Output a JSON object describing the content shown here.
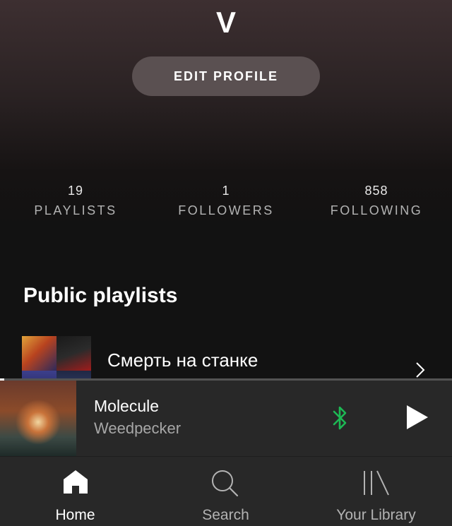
{
  "profile": {
    "username": "V",
    "edit_button_label": "EDIT PROFILE",
    "stats": [
      {
        "value": "19",
        "label": "PLAYLISTS"
      },
      {
        "value": "1",
        "label": "FOLLOWERS"
      },
      {
        "value": "858",
        "label": "FOLLOWING"
      }
    ]
  },
  "public_playlists": {
    "title": "Public playlists",
    "items": [
      {
        "name": "Смерть на станке",
        "chevron": "chevron-right-icon"
      }
    ]
  },
  "now_playing": {
    "title": "Molecule",
    "artist": "Weedpecker",
    "progress_percent": 1,
    "bluetooth_color": "#1db954",
    "play_icon": "play-icon"
  },
  "tabbar": {
    "tabs": [
      {
        "label": "Home",
        "icon": "home-icon",
        "active": true
      },
      {
        "label": "Search",
        "icon": "search-icon",
        "active": false
      },
      {
        "label": "Your Library",
        "icon": "library-icon",
        "active": false
      }
    ]
  }
}
